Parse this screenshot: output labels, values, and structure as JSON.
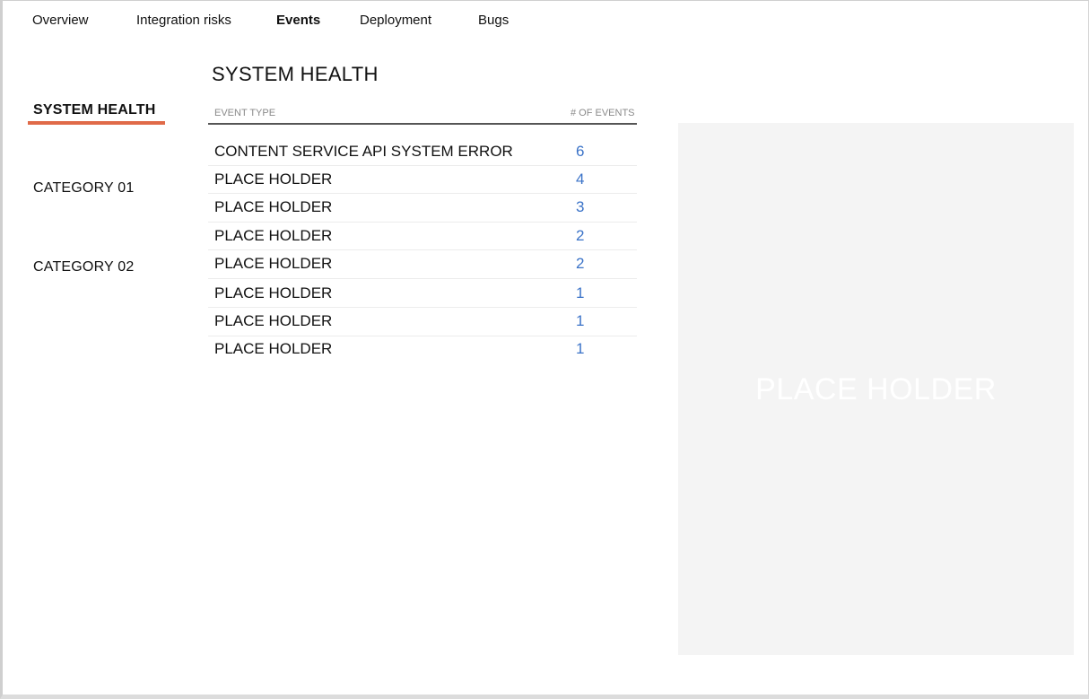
{
  "nav": {
    "items": [
      {
        "label": "Overview",
        "active": false
      },
      {
        "label": "Integration risks",
        "active": false
      },
      {
        "label": "Events",
        "active": true
      },
      {
        "label": "Deployment",
        "active": false
      },
      {
        "label": "Bugs",
        "active": false
      }
    ]
  },
  "sidebar": {
    "items": [
      {
        "label": "SYSTEM HEALTH",
        "active": true
      },
      {
        "label": "CATEGORY 01",
        "active": false
      },
      {
        "label": "CATEGORY 02",
        "active": false
      }
    ],
    "active_color": "#e06a48"
  },
  "main": {
    "title": "SYSTEM HEALTH",
    "table": {
      "headers": {
        "type": "EVENT TYPE",
        "count": "# OF EVENTS"
      },
      "rows": [
        {
          "type": "CONTENT SERVICE API SYSTEM ERROR",
          "count": "6"
        },
        {
          "type": "PLACE HOLDER",
          "count": "4"
        },
        {
          "type": "PLACE HOLDER",
          "count": "3"
        },
        {
          "type": "PLACE HOLDER",
          "count": "2"
        },
        {
          "type": "PLACE HOLDER",
          "count": "2"
        },
        {
          "type": "PLACE HOLDER",
          "count": "1"
        },
        {
          "type": "PLACE HOLDER",
          "count": "1"
        },
        {
          "type": "PLACE HOLDER",
          "count": "1"
        }
      ],
      "count_color": "#3b73c8"
    }
  },
  "panel": {
    "label": "PLACE HOLDER"
  }
}
